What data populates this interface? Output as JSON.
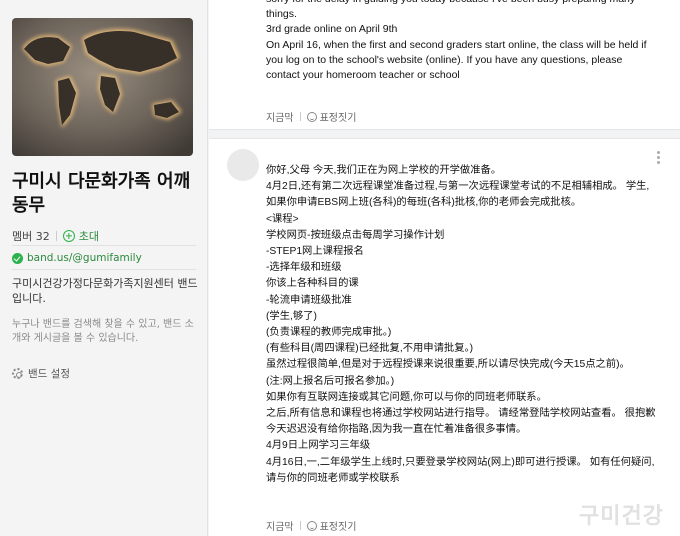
{
  "sidebar": {
    "band_name": "구미시 다문화가족 어깨동무",
    "member_label": "멤버 32",
    "invite_label": "초대",
    "band_url": "band.us/@gumifamily",
    "description": "구미시건강가정다문화가족지원센터 밴드입니다.",
    "search_note": "누구나 밴드를 검색해 찾을 수 있고, 밴드 소개와 게시글을 볼 수 있습니다.",
    "settings_label": "밴드 설정"
  },
  "post1": {
    "lines": [
      "sorry for the delay in guiding you today because I've been busy preparing many things.",
      "3rd grade online on April 9th",
      "On April 16, when the first and second graders start online, the class will be held if you log on to the school's website (online). If you have any questions, please contact your homeroom teacher or school"
    ],
    "comment_label": "지금막",
    "emote_label": "표정짓기"
  },
  "post2": {
    "lines": [
      "你好,父母 今天,我们正在为网上学校的开学做准备。",
      "4月2日,还有第二次远程课堂准备过程,与第一次远程课堂考试的不足相辅相成。 学生,如果你申请EBS网上班(各科)的每班(各科)批核,你的老师会完成批核。",
      " <课程>",
      "学校网页-按班级点击每周学习操作计划",
      "-STEP1网上课程报名",
      "-选择年级和班级",
      "你该上各种科目的课",
      "-轮流申请班级批准",
      "(学生,够了)",
      "(负责课程的教师完成审批。)",
      "(有些科目(周四课程)已经批复,不用申请批复。)",
      "虽然过程很简单,但是对于远程授课来说很重要,所以请尽快完成(今天15点之前)。",
      "(注:网上报名后可报名参加。)",
      "如果你有互联网连接或其它问题,你可以与你的同班老师联系。",
      "之后,所有信息和课程也将通过学校网站进行指导。 请经常登陆学校网站查看。 很抱歉今天迟迟没有给你指路,因为我一直在忙着准备很多事情。",
      "4月9日上网学习三年级",
      "4月16日,一,二年级学生上线时,只要登录学校网站(网上)即可进行授课。 如有任何疑问,请与你的同班老师或学校联系"
    ],
    "comment_label": "지금막",
    "emote_label": "표정짓기"
  },
  "watermark": "구미건강"
}
